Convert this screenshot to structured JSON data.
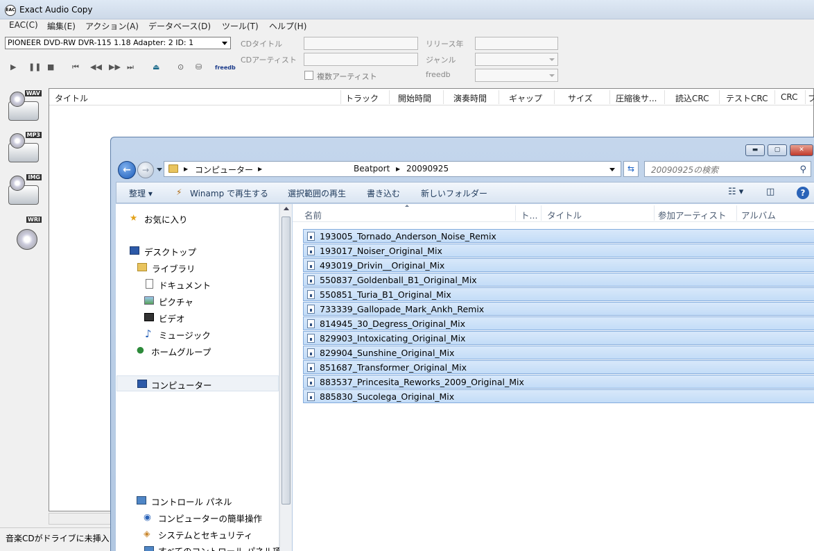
{
  "eac": {
    "title": "Exact Audio Copy",
    "menu": [
      "EAC(C)",
      "編集(E)",
      "アクション(A)",
      "データベース(D)",
      "ツール(T)",
      "ヘルプ(H)"
    ],
    "drive": "PIONEER DVD-RW  DVR-115 1.18   Adapter: 2  ID: 1",
    "labels": {
      "cd_title": "CDタイトル",
      "cd_artist": "CDアーティスト",
      "release_year": "リリース年",
      "genre": "ジャンル",
      "freedb": "freedb",
      "multi_artist": "複数アーティスト"
    },
    "freedb_logo": "freedb",
    "format_buttons": [
      "WAV",
      "MP3",
      "IMG",
      "WRI"
    ],
    "columns": [
      "タイトル",
      "トラック",
      "開始時間",
      "演奏時間",
      "ギャップ",
      "サイズ",
      "圧縮後サ...",
      "読込CRC",
      "テストCRC",
      "CRC",
      "フ"
    ],
    "status": "音楽CDがドライブに未挿入"
  },
  "explorer": {
    "breadcrumb": [
      "コンピューター",
      "Beatport",
      "20090925"
    ],
    "search_placeholder": "20090925の検索",
    "commands": [
      "整理 ▾",
      "Winamp で再生する",
      "選択範囲の再生",
      "書き込む",
      "新しいフォルダー"
    ],
    "nav": {
      "favorites": "お気に入り",
      "desktop": "デスクトップ",
      "library": "ライブラリ",
      "documents": "ドキュメント",
      "pictures": "ピクチャ",
      "video": "ビデオ",
      "music": "ミュージック",
      "homegroup": "ホームグループ",
      "computer": "コンピューター",
      "control_panel": "コントロール パネル",
      "ease": "コンピューターの簡単操作",
      "security": "システムとセキュリティ",
      "all_cp": "すべてのコントロール パネル項目"
    },
    "columns": [
      "名前",
      "ト...",
      "タイトル",
      "参加アーティスト",
      "アルバム"
    ],
    "files": [
      "193005_Tornado_Anderson_Noise_Remix",
      "193017_Noiser_Original_Mix",
      "493019_Drivin__Original_Mix",
      "550837_Goldenball_B1_Original_Mix",
      "550851_Turia_B1_Original_Mix",
      "733339_Gallopade_Mark_Ankh_Remix",
      "814945_30_Degress_Original_Mix",
      "829903_Intoxicating_Original_Mix",
      "829904_Sunshine_Original_Mix",
      "851687_Transformer_Original_Mix",
      "883537_Princesita_Reworks_2009_Original_Mix",
      "885830_Sucolega_Original_Mix"
    ]
  }
}
